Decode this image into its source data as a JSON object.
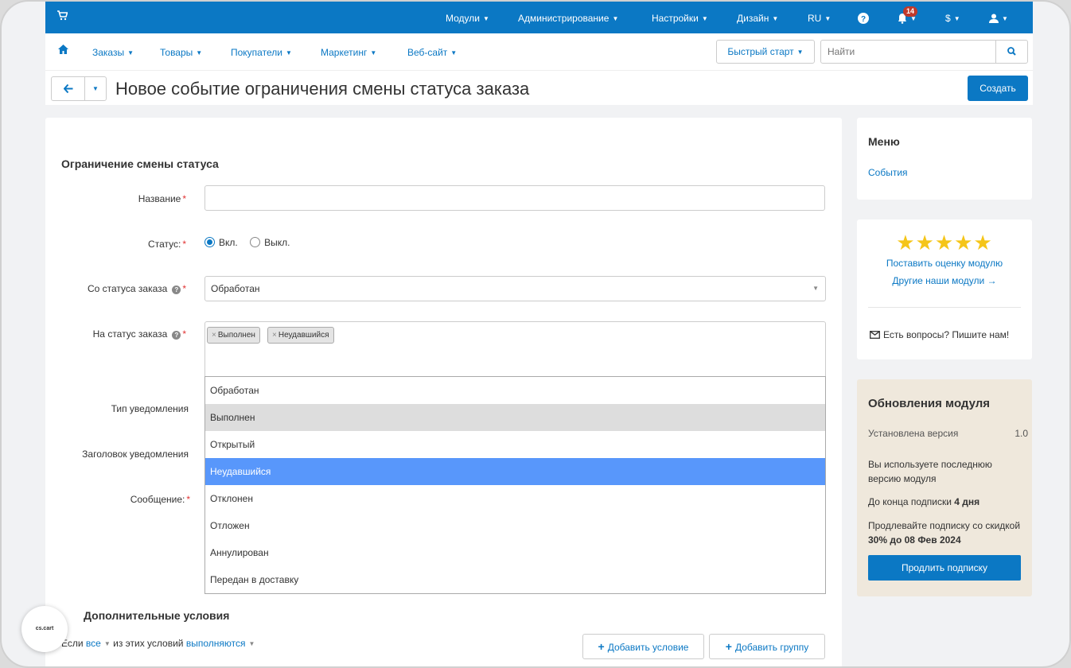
{
  "topbar": {
    "items": [
      "Модули",
      "Администрирование",
      "Настройки",
      "Дизайн",
      "RU",
      "?",
      "$"
    ],
    "notifications_count": "14"
  },
  "subnav": {
    "items": [
      "Заказы",
      "Товары",
      "Покупатели",
      "Маркетинг",
      "Веб-сайт"
    ],
    "quick_start": "Быстрый старт",
    "search_placeholder": "Найти"
  },
  "header": {
    "title": "Новое событие ограничения смены статуса заказа",
    "create_label": "Создать"
  },
  "form": {
    "section_title": "Ограничение смены статуса",
    "name_label": "Название",
    "status_label": "Статус:",
    "status_on": "Вкл.",
    "status_off": "Выкл.",
    "from_status_label": "Со статуса заказа",
    "from_status_value": "Обработан",
    "to_status_label": "На статус заказа",
    "to_status_tags": [
      "Выполнен",
      "Неудавшийся"
    ],
    "notification_type_label": "Тип уведомления",
    "notification_header_label": "Заголовок уведомления",
    "message_label": "Сообщение:",
    "dropdown_options": [
      "Обработан",
      "Выполнен",
      "Открытый",
      "Неудавшийся",
      "Отклонен",
      "Отложен",
      "Аннулирован",
      "Передан в доставку"
    ],
    "additional_title": "Дополнительные условия",
    "cond_prefix": "Если",
    "cond_all": "все",
    "cond_middle": "из этих условий",
    "cond_fulfilled": "выполняются",
    "add_condition": "Добавить условие",
    "add_group": "Добавить группу"
  },
  "sidebar": {
    "menu_title": "Меню",
    "menu_link": "События",
    "rate_link": "Поставить оценку модулю",
    "other_modules": "Другие наши модули →",
    "questions": "Есть вопросы? Пишите нам!",
    "updates_title": "Обновления модуля",
    "installed_label": "Установлена версия",
    "installed_version": "1.0",
    "latest_text": "Вы используете последнюю версию модуля",
    "sub_prefix": "До конца подписки",
    "sub_days": "4 дня",
    "renew_text": "Продлевайте подписку со скидкой",
    "renew_discount": "30% до 08 Фев 2024",
    "renew_button": "Продлить подписку"
  },
  "badge": {
    "text": "cs.cart"
  },
  "colors": {
    "accent": "#0b78c4",
    "highlight": "#5897fb",
    "required": "#e13333",
    "stars": "#f5c518"
  }
}
